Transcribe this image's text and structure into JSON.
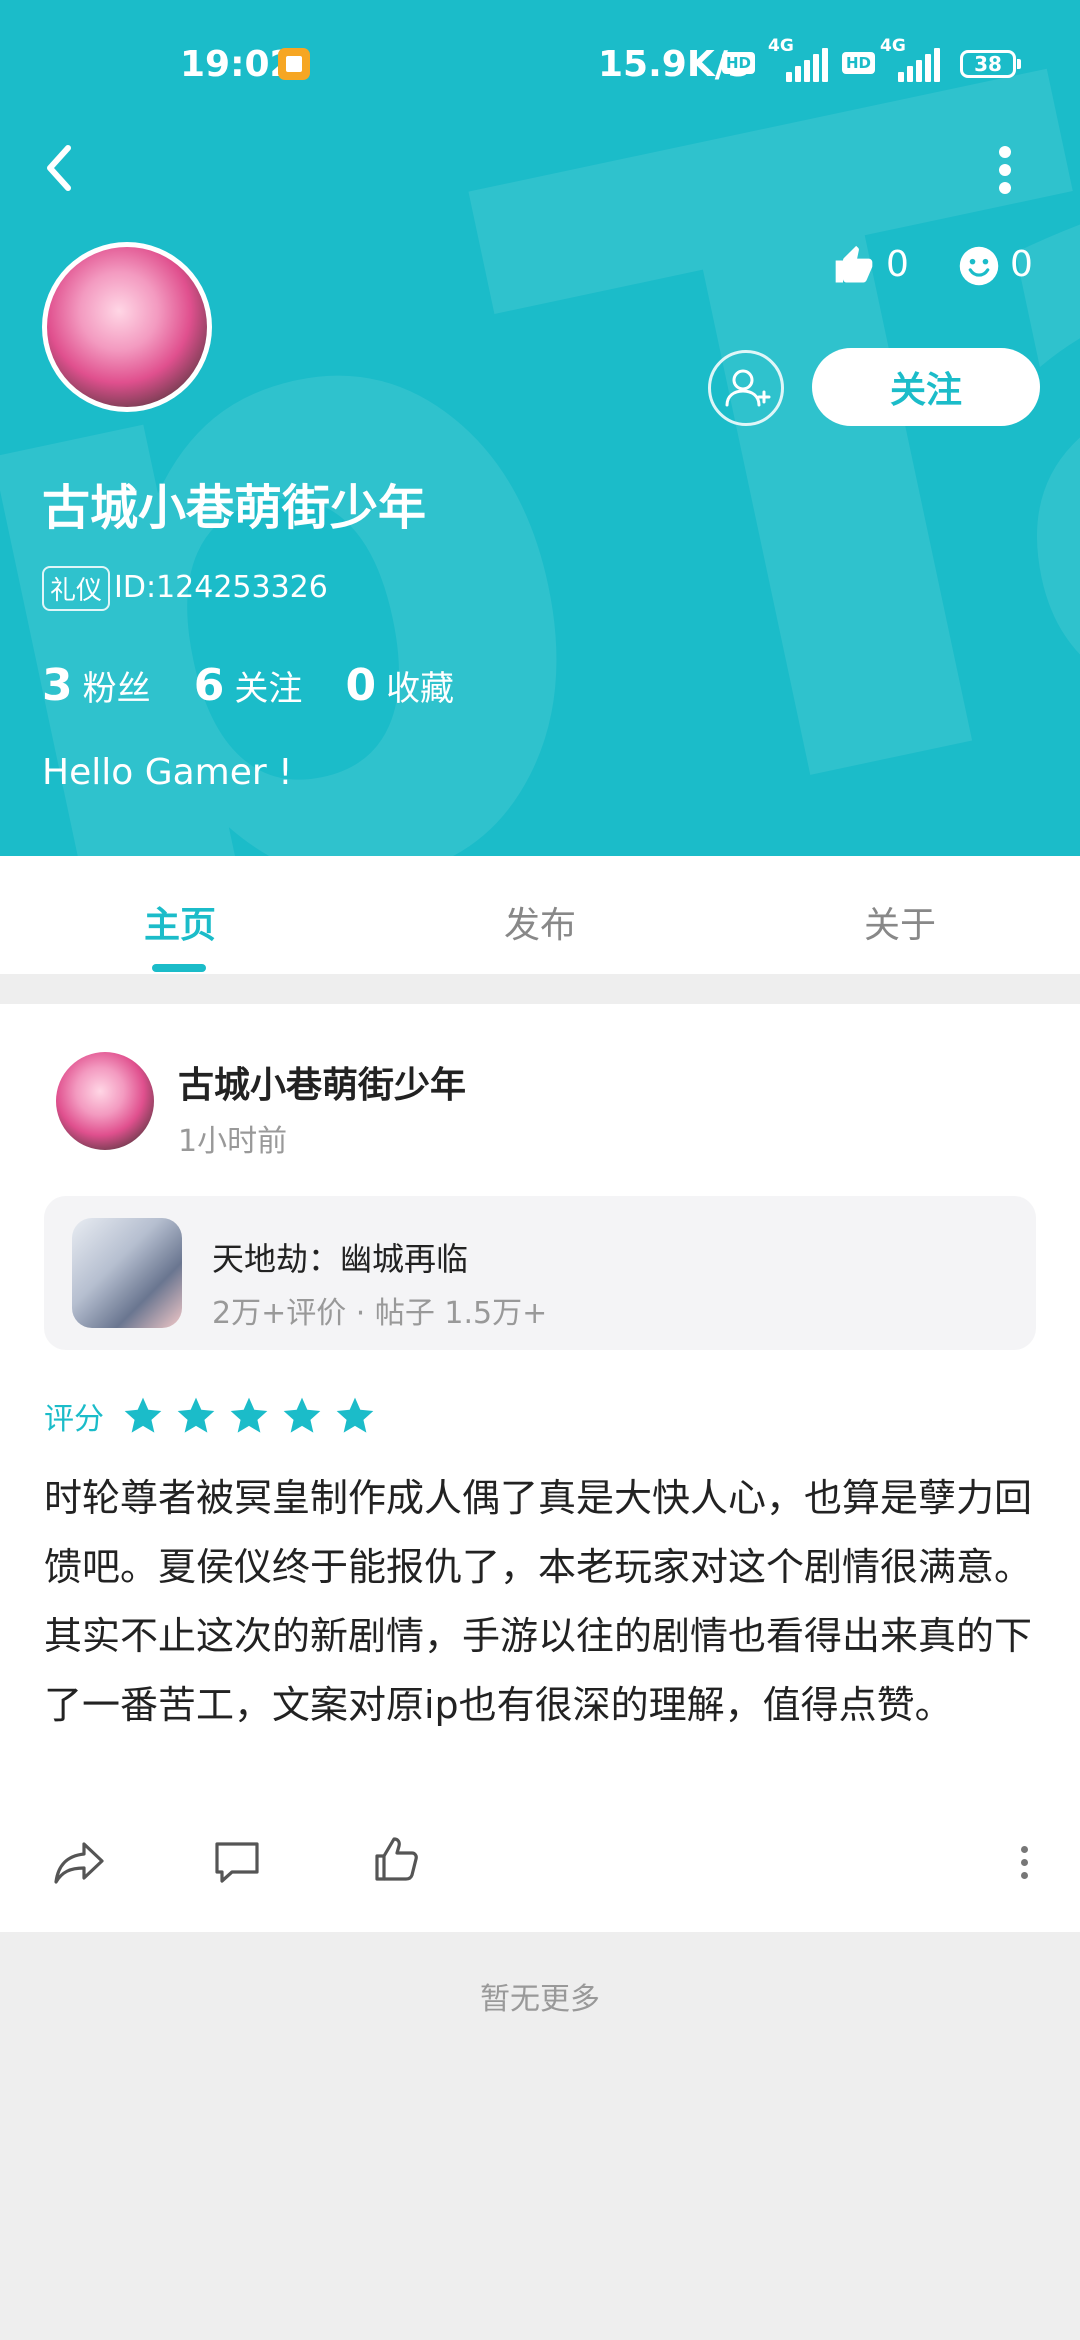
{
  "colors": {
    "accent": "#1bbcc9",
    "background": "#eeeeee",
    "card": "#ffffff"
  },
  "status_bar": {
    "time": "19:02",
    "net_speed": "15.9K/s",
    "hd_badge": "HD",
    "network": "4G",
    "battery": "38"
  },
  "profile": {
    "name": "古城小巷萌街少年",
    "id_badge": "礼仪",
    "id_text": "ID:124253326",
    "likes": "0",
    "smiles": "0",
    "follow_label": "关注",
    "stats": [
      {
        "num": "3",
        "label": "粉丝"
      },
      {
        "num": "6",
        "label": "关注"
      },
      {
        "num": "0",
        "label": "收藏"
      }
    ],
    "bio": "Hello Gamer !"
  },
  "tabs": [
    {
      "label": "主页",
      "active": true
    },
    {
      "label": "发布",
      "active": false
    },
    {
      "label": "关于",
      "active": false
    }
  ],
  "post": {
    "author": "古城小巷萌街少年",
    "time": "1小时前",
    "game": {
      "name": "天地劫：幽城再临",
      "meta": "2万+评价 · 帖子 1.5万+"
    },
    "rating_label": "评分",
    "rating": 5,
    "body": "时轮尊者被冥皇制作成人偶了真是大快人心，也算是孽力回馈吧。夏侯仪终于能报仇了，本老玩家对这个剧情很满意。其实不止这次的新剧情，手游以往的剧情也看得出来真的下了一番苦工，文案对原ip也有很深的理解，值得点赞。"
  },
  "footer": {
    "no_more": "暂无更多"
  },
  "icons": [
    "back-icon",
    "more-vertical-icon",
    "thumbs-up-icon",
    "smile-icon",
    "add-friend-icon",
    "star-icon",
    "share-icon",
    "comment-icon",
    "like-icon",
    "more-icon"
  ]
}
